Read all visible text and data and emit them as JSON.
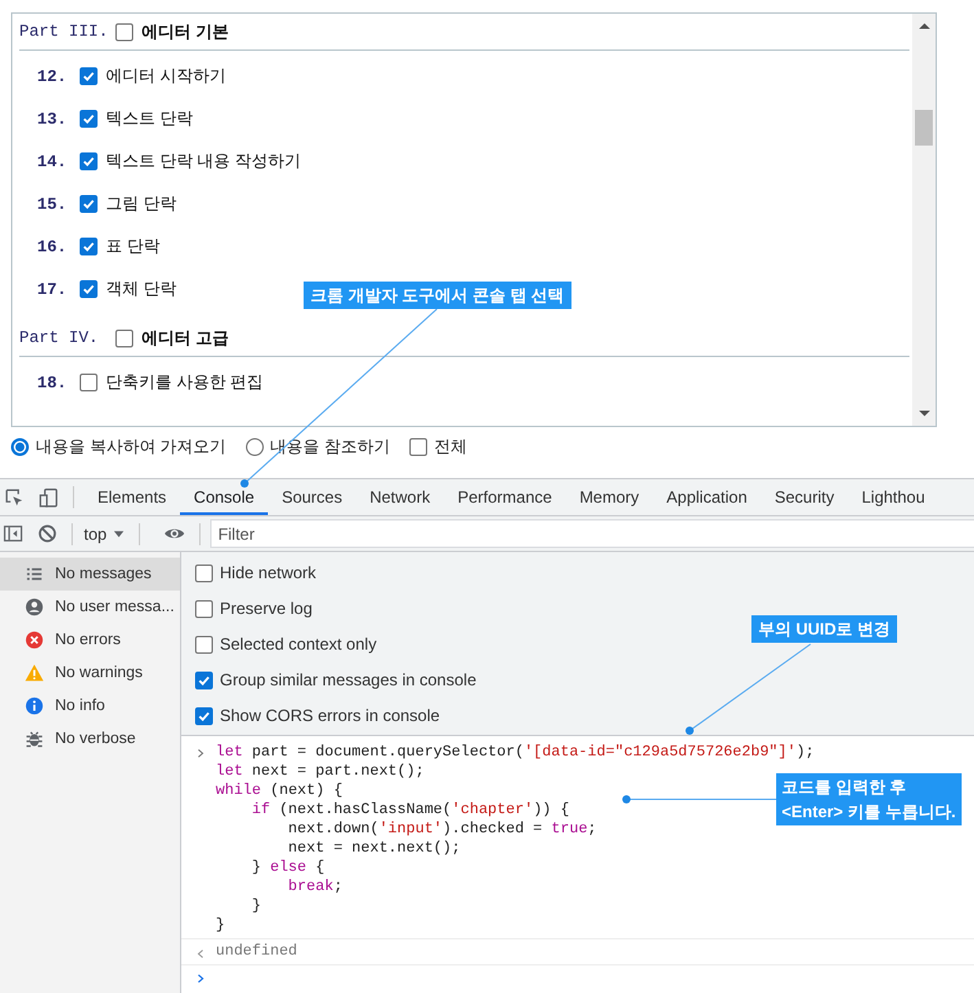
{
  "outline": {
    "sections": [
      {
        "label": "Part III.",
        "title": "에디터 기본",
        "checked": false,
        "items": [
          {
            "number": "12.",
            "title": "에디터 시작하기",
            "checked": true
          },
          {
            "number": "13.",
            "title": "텍스트 단락",
            "checked": true
          },
          {
            "number": "14.",
            "title": "텍스트 단락 내용 작성하기",
            "checked": true
          },
          {
            "number": "15.",
            "title": "그림 단락",
            "checked": true
          },
          {
            "number": "16.",
            "title": "표 단락",
            "checked": true
          },
          {
            "number": "17.",
            "title": "객체 단락",
            "checked": true
          }
        ]
      },
      {
        "label": "Part IV.",
        "title": "에디터 고급",
        "checked": false,
        "items": [
          {
            "number": "18.",
            "title": "단축키를 사용한 편집",
            "checked": false
          }
        ]
      }
    ]
  },
  "import_options": [
    {
      "kind": "radio",
      "label": "내용을 복사하여 가져오기",
      "selected": true
    },
    {
      "kind": "radio",
      "label": "내용을 참조하기",
      "selected": false
    },
    {
      "kind": "checkbox",
      "label": "전체",
      "checked": false
    }
  ],
  "devtools": {
    "tabs": [
      {
        "label": "Elements",
        "selected": false
      },
      {
        "label": "Console",
        "selected": true
      },
      {
        "label": "Sources",
        "selected": false
      },
      {
        "label": "Network",
        "selected": false
      },
      {
        "label": "Performance",
        "selected": false
      },
      {
        "label": "Memory",
        "selected": false
      },
      {
        "label": "Application",
        "selected": false
      },
      {
        "label": "Security",
        "selected": false
      },
      {
        "label": "Lighthou",
        "selected": false
      }
    ],
    "context": "top",
    "filter": {
      "placeholder": "Filter"
    },
    "sidebar": [
      {
        "kind": "list",
        "label": "No messages",
        "selected": true
      },
      {
        "kind": "user",
        "label": "No user messa...",
        "selected": false
      },
      {
        "kind": "error",
        "label": "No errors",
        "selected": false
      },
      {
        "kind": "warning",
        "label": "No warnings",
        "selected": false
      },
      {
        "kind": "info",
        "label": "No info",
        "selected": false
      },
      {
        "kind": "verbose",
        "label": "No verbose",
        "selected": false
      }
    ],
    "settings": [
      {
        "label": "Hide network",
        "checked": false
      },
      {
        "label": "Preserve log",
        "checked": false
      },
      {
        "label": "Selected context only",
        "checked": false
      },
      {
        "label": "Group similar messages in console",
        "checked": true
      },
      {
        "label": "Show CORS errors in console",
        "checked": true
      }
    ],
    "console": {
      "input": [
        [
          {
            "kind": "keyword",
            "text": "let"
          },
          {
            "kind": "plain",
            "text": " part = document.querySelector("
          },
          {
            "kind": "string",
            "text": "'[data-id=\"c129a5d75726e2b9\"]'"
          },
          {
            "kind": "plain",
            "text": ");"
          }
        ],
        [
          {
            "kind": "keyword",
            "text": "let"
          },
          {
            "kind": "plain",
            "text": " next = part.next();"
          }
        ],
        [
          {
            "kind": "keyword",
            "text": "while"
          },
          {
            "kind": "plain",
            "text": " (next) {"
          }
        ],
        [
          {
            "kind": "keyword",
            "text": "    if"
          },
          {
            "kind": "plain",
            "text": " (next.hasClassName("
          },
          {
            "kind": "string",
            "text": "'chapter'"
          },
          {
            "kind": "plain",
            "text": ")) {"
          }
        ],
        [
          {
            "kind": "plain",
            "text": "        next.down("
          },
          {
            "kind": "string",
            "text": "'input'"
          },
          {
            "kind": "plain",
            "text": ").checked = "
          },
          {
            "kind": "keyword",
            "text": "true"
          },
          {
            "kind": "plain",
            "text": ";"
          }
        ],
        [
          {
            "kind": "plain",
            "text": "        next = next.next();"
          }
        ],
        [
          {
            "kind": "plain",
            "text": "    } "
          },
          {
            "kind": "keyword",
            "text": "else"
          },
          {
            "kind": "plain",
            "text": " {"
          }
        ],
        [
          {
            "kind": "keyword",
            "text": "        break"
          },
          {
            "kind": "plain",
            "text": ";"
          }
        ],
        [
          {
            "kind": "plain",
            "text": "    }"
          }
        ],
        [
          {
            "kind": "plain",
            "text": "}"
          }
        ]
      ],
      "result": "undefined"
    }
  },
  "annotations": [
    {
      "text": "크롬 개발자 도구에서 콘솔 탭 선택"
    },
    {
      "text": "부의 UUID로 변경"
    },
    {
      "text": "코드를 입력한 후\n<Enter> 키를 누릅니다."
    }
  ]
}
